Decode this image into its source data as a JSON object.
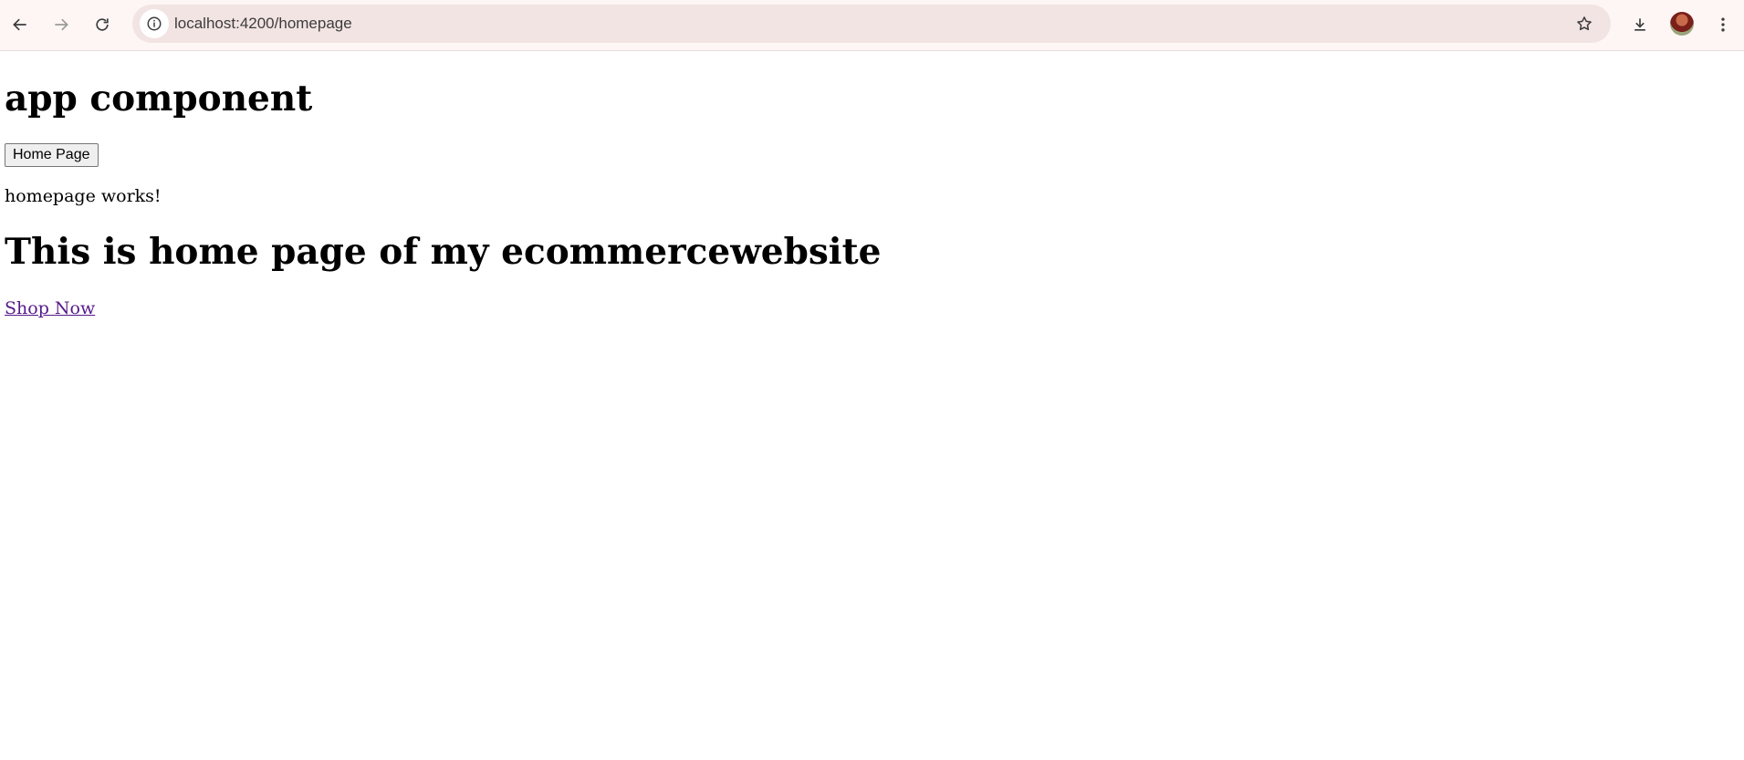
{
  "browser": {
    "url": "localhost:4200/homepage",
    "icons": {
      "back": "arrow-left-icon",
      "forward": "arrow-right-icon",
      "reload": "reload-icon",
      "site_info": "info-icon",
      "bookmark": "star-icon",
      "downloads": "download-icon",
      "profile": "avatar",
      "menu": "kebab-menu-icon"
    }
  },
  "page": {
    "app_title": "app component",
    "home_button_label": "Home Page",
    "homepage_status": "homepage works!",
    "home_heading": "This is home page of my ecommercewebsite",
    "shop_link_label": "Shop Now"
  },
  "colors": {
    "toolbar_bg": "#fdf6f5",
    "omnibox_bg": "#f2e4e3",
    "visited_link": "#551a8b"
  }
}
